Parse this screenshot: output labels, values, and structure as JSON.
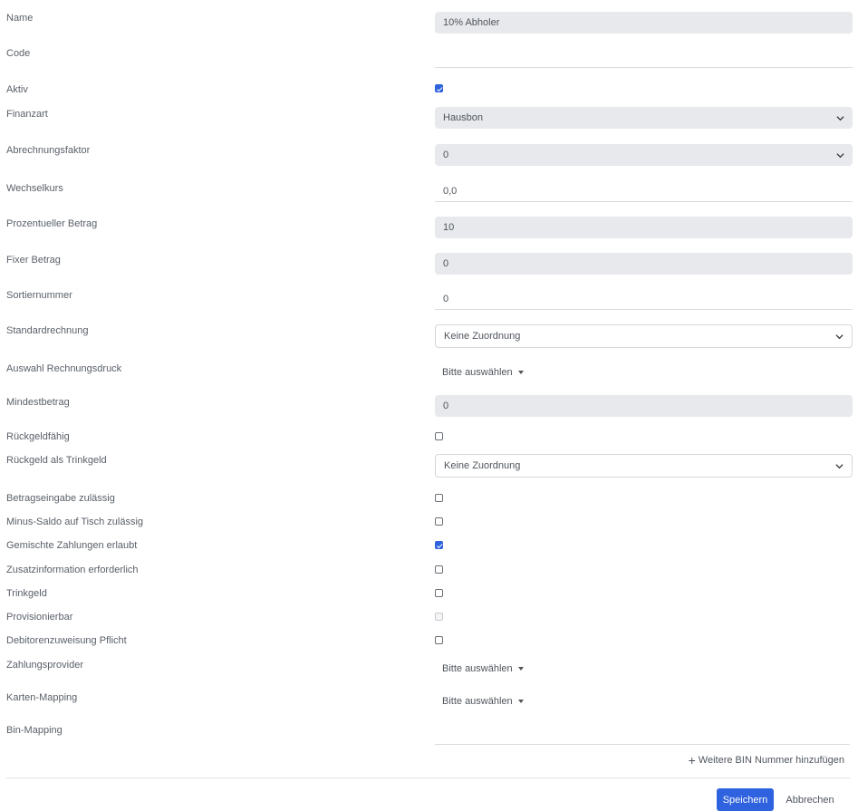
{
  "form": {
    "name": {
      "label": "Name",
      "value": "10% Abholer"
    },
    "code": {
      "label": "Code",
      "value": ""
    },
    "aktiv": {
      "label": "Aktiv",
      "checked": true
    },
    "finanzart": {
      "label": "Finanzart",
      "value": "Hausbon"
    },
    "abrechnungsfaktor": {
      "label": "Abrechnungsfaktor",
      "value": "0"
    },
    "wechselkurs": {
      "label": "Wechselkurs",
      "value": "0,0"
    },
    "prozentueller_betrag": {
      "label": "Prozentueller Betrag",
      "value": "10"
    },
    "fixer_betrag": {
      "label": "Fixer Betrag",
      "value": "0"
    },
    "sortiernummer": {
      "label": "Sortiernummer",
      "value": "0"
    },
    "standardrechnung": {
      "label": "Standardrechnung",
      "value": "Keine Zuordnung"
    },
    "auswahl_rechnungsdruck": {
      "label": "Auswahl Rechnungsdruck",
      "value": "Bitte auswählen"
    },
    "mindestbetrag": {
      "label": "Mindestbetrag",
      "value": "0"
    },
    "rueckgeldfaehig": {
      "label": "Rückgeldfähig",
      "checked": false
    },
    "rueckgeld_trinkgeld": {
      "label": "Rückgeld als Trinkgeld",
      "value": "Keine Zuordnung"
    },
    "betragseingabe": {
      "label": "Betragseingabe zulässig",
      "checked": false
    },
    "minus_saldo": {
      "label": "Minus-Saldo auf Tisch zulässig",
      "checked": false
    },
    "gemischte_zahlungen": {
      "label": "Gemischte Zahlungen erlaubt",
      "checked": true
    },
    "zusatzinformation": {
      "label": "Zusatzinformation erforderlich",
      "checked": false
    },
    "trinkgeld": {
      "label": "Trinkgeld",
      "checked": false
    },
    "provisionierbar": {
      "label": "Provisionierbar",
      "checked": false,
      "disabled": true
    },
    "debitorenzuweisung": {
      "label": "Debitorenzuweisung Pflicht",
      "checked": false
    },
    "zahlungsprovider": {
      "label": "Zahlungsprovider",
      "value": "Bitte auswählen"
    },
    "karten_mapping": {
      "label": "Karten-Mapping",
      "value": "Bitte auswählen"
    },
    "bin_mapping": {
      "label": "Bin-Mapping",
      "add_label": "Weitere BIN Nummer hinzufügen"
    }
  },
  "actions": {
    "save": "Speichern",
    "cancel": "Abbrechen"
  },
  "colors": {
    "primary": "#2f62de",
    "disabled_bg": "#e7e9ec"
  },
  "icons": {
    "chevron": "chevron-down-icon",
    "caret": "caret-down-icon",
    "plus": "plus-icon"
  }
}
